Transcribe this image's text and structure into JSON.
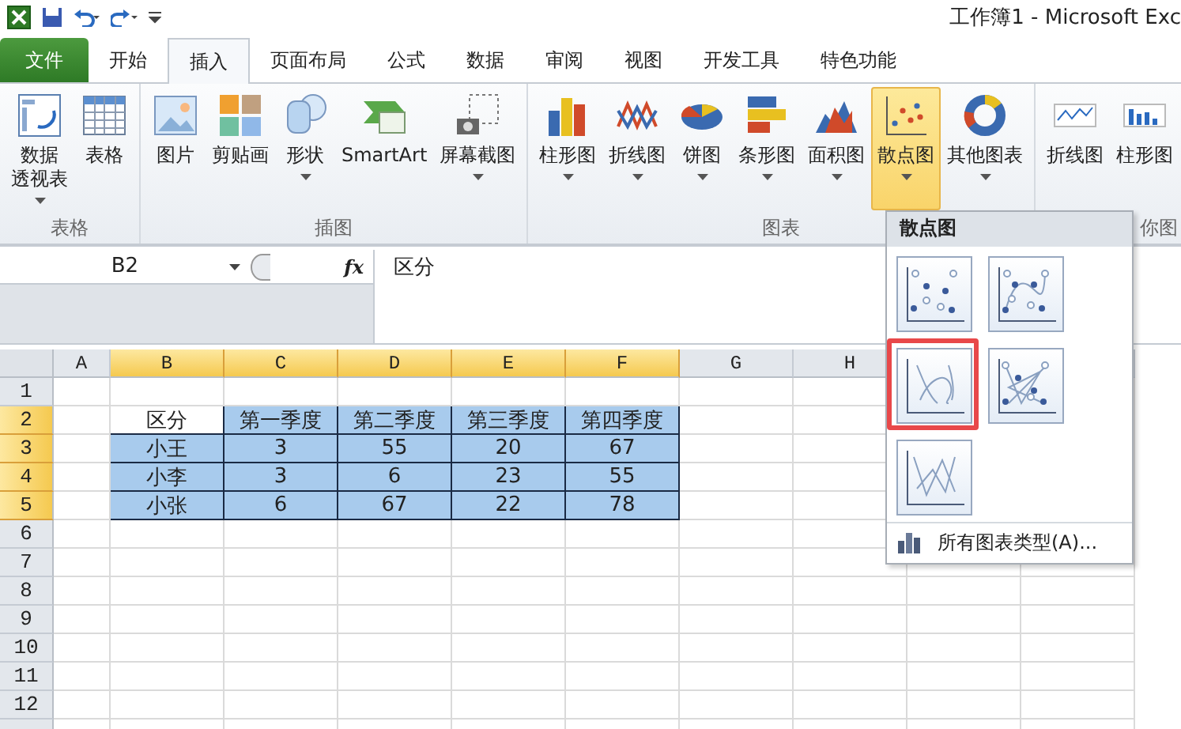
{
  "window": {
    "title": "工作簿1 - Microsoft Exc"
  },
  "tabs": [
    {
      "label": "文件",
      "kind": "file",
      "selected": false
    },
    {
      "label": "开始",
      "kind": "tab",
      "selected": false
    },
    {
      "label": "插入",
      "kind": "tab",
      "selected": true
    },
    {
      "label": "页面布局",
      "kind": "tab",
      "selected": false
    },
    {
      "label": "公式",
      "kind": "tab",
      "selected": false
    },
    {
      "label": "数据",
      "kind": "tab",
      "selected": false
    },
    {
      "label": "审阅",
      "kind": "tab",
      "selected": false
    },
    {
      "label": "视图",
      "kind": "tab",
      "selected": false
    },
    {
      "label": "开发工具",
      "kind": "tab",
      "selected": false
    },
    {
      "label": "特色功能",
      "kind": "tab",
      "selected": false
    }
  ],
  "ribbon_groups": [
    {
      "label": "表格",
      "buttons": [
        {
          "label": [
            "数据",
            "透视表"
          ],
          "kind": "pivot",
          "has_menu": true,
          "selected": false
        },
        {
          "label": "表格",
          "kind": "table",
          "has_menu": false,
          "selected": false
        }
      ]
    },
    {
      "label": "插图",
      "buttons": [
        {
          "label": "图片",
          "kind": "picture",
          "has_menu": false,
          "selected": false
        },
        {
          "label": "剪贴画",
          "kind": "clipart",
          "has_menu": false,
          "selected": false
        },
        {
          "label": "形状",
          "kind": "shapes",
          "has_menu": true,
          "selected": false
        },
        {
          "label": "SmartArt",
          "kind": "smartart",
          "has_menu": false,
          "selected": false
        },
        {
          "label": "屏幕截图",
          "kind": "screenshot",
          "has_menu": true,
          "selected": false
        }
      ]
    },
    {
      "label": "图表",
      "buttons": [
        {
          "label": "柱形图",
          "kind": "column",
          "has_menu": true,
          "selected": false
        },
        {
          "label": "折线图",
          "kind": "line",
          "has_menu": true,
          "selected": false
        },
        {
          "label": "饼图",
          "kind": "pie",
          "has_menu": true,
          "selected": false
        },
        {
          "label": "条形图",
          "kind": "bar",
          "has_menu": true,
          "selected": false
        },
        {
          "label": "面积图",
          "kind": "area",
          "has_menu": true,
          "selected": false
        },
        {
          "label": "散点图",
          "kind": "scatter",
          "has_menu": true,
          "selected": true
        },
        {
          "label": "其他图表",
          "kind": "other",
          "has_menu": true,
          "selected": false
        }
      ]
    },
    {
      "label": "你图",
      "buttons": [
        {
          "label": "折线图",
          "kind": "spark-line",
          "has_menu": false,
          "selected": false
        },
        {
          "label": "柱形图",
          "kind": "spark-column",
          "has_menu": false,
          "selected": false
        }
      ]
    }
  ],
  "formula_bar": {
    "name_box": "B2",
    "fx": "fx",
    "value": "区分"
  },
  "columns": [
    {
      "label": "A",
      "selected": false
    },
    {
      "label": "B",
      "selected": true
    },
    {
      "label": "C",
      "selected": true
    },
    {
      "label": "D",
      "selected": true
    },
    {
      "label": "E",
      "selected": true
    },
    {
      "label": "F",
      "selected": true
    },
    {
      "label": "G",
      "selected": false
    },
    {
      "label": "H",
      "selected": false
    }
  ],
  "rows": [
    {
      "label": "1",
      "selected": false,
      "cells": []
    },
    {
      "label": "2",
      "selected": true,
      "cells": [
        "区分",
        "第一季度",
        "第二季度",
        "第三季度",
        "第四季度"
      ]
    },
    {
      "label": "3",
      "selected": true,
      "cells": [
        "小王",
        "3",
        "55",
        "20",
        "67"
      ]
    },
    {
      "label": "4",
      "selected": true,
      "cells": [
        "小李",
        "3",
        "6",
        "23",
        "55"
      ]
    },
    {
      "label": "5",
      "selected": true,
      "cells": [
        "小张",
        "6",
        "67",
        "22",
        "78"
      ]
    },
    {
      "label": "6",
      "selected": false,
      "cells": []
    },
    {
      "label": "7",
      "selected": false,
      "cells": []
    },
    {
      "label": "8",
      "selected": false,
      "cells": []
    },
    {
      "label": "9",
      "selected": false,
      "cells": []
    },
    {
      "label": "10",
      "selected": false,
      "cells": []
    },
    {
      "label": "11",
      "selected": false,
      "cells": []
    },
    {
      "label": "12",
      "selected": false,
      "cells": []
    }
  ],
  "scatter_menu": {
    "title": "散点图",
    "options": [
      {
        "kind": "markers",
        "marked": false
      },
      {
        "kind": "smooth-markers",
        "marked": false
      },
      {
        "kind": "smooth",
        "marked": true
      },
      {
        "kind": "straight-markers",
        "marked": false
      },
      {
        "kind": "straight",
        "marked": false
      }
    ],
    "footer": "所有图表类型(A)..."
  }
}
